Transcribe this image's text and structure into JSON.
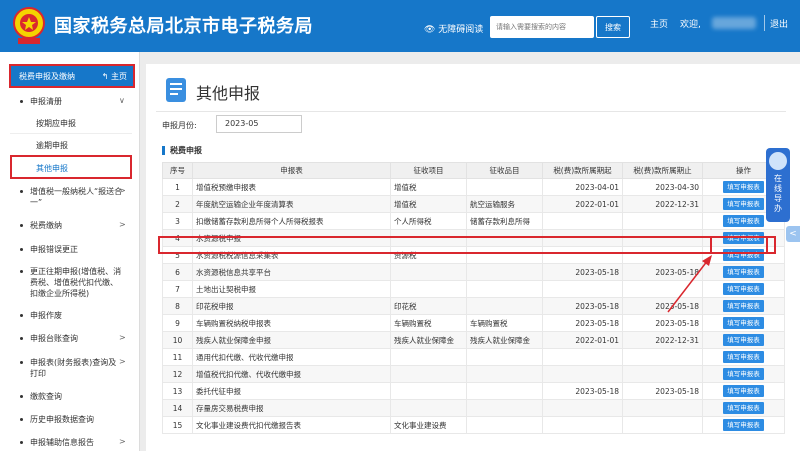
{
  "header": {
    "title": "国家税务总局北京市电子税务局",
    "accessibility": "无障碍阅读",
    "search_placeholder": "请输入需要搜索的内容",
    "search_button": "搜索",
    "home": "主页",
    "welcome": "欢迎,",
    "logout": "退出",
    "colors": {
      "brand": "#1677c9",
      "highlight": "#d9272e"
    }
  },
  "sidebar": {
    "header_label": "税费申报及缴纳",
    "header_home": "主页",
    "items": [
      {
        "label": "申报清册",
        "chevron": "∨"
      },
      {
        "label": "按期应申报"
      },
      {
        "label": "逾期申报"
      },
      {
        "label": "其他申报"
      },
      {
        "label": "增值税一般纳税人“报送合一”",
        "chevron": ">"
      },
      {
        "label": "税费缴纳",
        "chevron": ">"
      },
      {
        "label": "申报错误更正"
      },
      {
        "label": "更正往期申报(增值税、消费税、增值税代扣代缴、扣缴企业所得税)"
      },
      {
        "label": "申报作废"
      },
      {
        "label": "申报台账查询",
        "chevron": ">"
      },
      {
        "label": "申报表(财务报表)查询及打印",
        "chevron": ">"
      },
      {
        "label": "缴款查询"
      },
      {
        "label": "历史申报数据查询"
      },
      {
        "label": "申报辅助信息报告",
        "chevron": ">"
      }
    ]
  },
  "main": {
    "title": "其他申报",
    "period_label": "申报月份:",
    "period_value": "2023-05",
    "section": "税费申报",
    "columns": [
      "序号",
      "申报表",
      "征收项目",
      "征收品目",
      "税(费)款所属期起",
      "税(费)款所属期止",
      "操作"
    ],
    "action": "填写申报表",
    "rows": [
      {
        "no": "1",
        "form": "增值税预缴申报表",
        "item": "增值税",
        "sub": "",
        "start": "2023-04-01",
        "end": "2023-04-30"
      },
      {
        "no": "2",
        "form": "年度航空运输企业年度清算表",
        "item": "增值税",
        "sub": "航空运输服务",
        "start": "2022-01-01",
        "end": "2022-12-31"
      },
      {
        "no": "3",
        "form": "扣缴储蓄存款利息所得个人所得税报表",
        "item": "个人所得税",
        "sub": "储蓄存款利息所得",
        "start": "",
        "end": ""
      },
      {
        "no": "4",
        "form": "水资源税申报",
        "item": "",
        "sub": "",
        "start": "",
        "end": ""
      },
      {
        "no": "5",
        "form": "水资源税税源信息采集表",
        "item": "资源税",
        "sub": "",
        "start": "",
        "end": ""
      },
      {
        "no": "6",
        "form": "水资源税信息共享平台",
        "item": "",
        "sub": "",
        "start": "2023-05-18",
        "end": "2023-05-18"
      },
      {
        "no": "7",
        "form": "土地出让契税申报",
        "item": "",
        "sub": "",
        "start": "",
        "end": ""
      },
      {
        "no": "8",
        "form": "印花税申报",
        "item": "印花税",
        "sub": "",
        "start": "2023-05-18",
        "end": "2023-05-18"
      },
      {
        "no": "9",
        "form": "车辆购置税纳税申报表",
        "item": "车辆购置税",
        "sub": "车辆购置税",
        "start": "2023-05-18",
        "end": "2023-05-18"
      },
      {
        "no": "10",
        "form": "残疾人就业保障金申报",
        "item": "残疾人就业保障金",
        "sub": "残疾人就业保障金",
        "start": "2022-01-01",
        "end": "2022-12-31"
      },
      {
        "no": "11",
        "form": "通用代扣代缴、代收代缴申报",
        "item": "",
        "sub": "",
        "start": "",
        "end": ""
      },
      {
        "no": "12",
        "form": "增值税代扣代缴、代收代缴申报",
        "item": "",
        "sub": "",
        "start": "",
        "end": ""
      },
      {
        "no": "13",
        "form": "委托代征申报",
        "item": "",
        "sub": "",
        "start": "2023-05-18",
        "end": "2023-05-18"
      },
      {
        "no": "14",
        "form": "存量房交易税费申报",
        "item": "",
        "sub": "",
        "start": "",
        "end": ""
      },
      {
        "no": "15",
        "form": "文化事业建设费代扣代缴报告表",
        "item": "文化事业建设费",
        "sub": "",
        "start": "",
        "end": ""
      }
    ]
  },
  "float": {
    "text": "在线导办",
    "tab": "<"
  }
}
